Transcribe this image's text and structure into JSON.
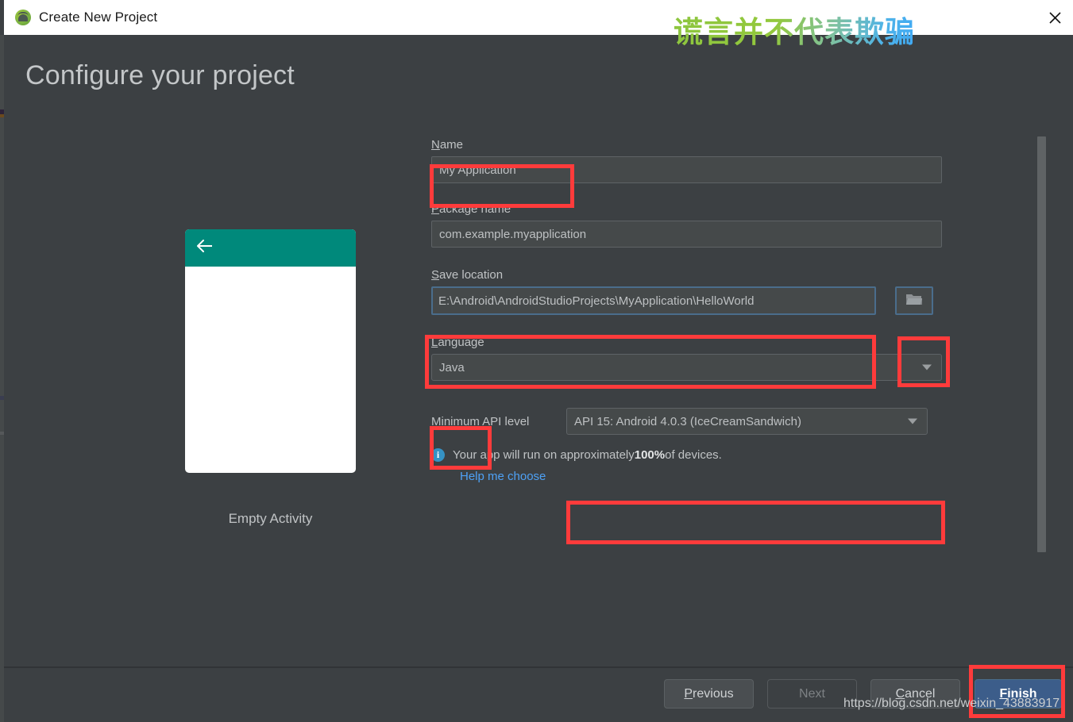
{
  "window": {
    "title": "Create New Project",
    "icon": "android-studio-icon",
    "close_label": "✕"
  },
  "watermarks": {
    "chinese": "谎言并不代表欺骗",
    "url": "https://blog.csdn.net/weixin_43883917"
  },
  "page": {
    "heading": "Configure your project"
  },
  "preview": {
    "template_name": "Empty Activity",
    "back_arrow": "←",
    "appbar_color": "#00897b"
  },
  "form": {
    "name": {
      "label_mnemonic": "N",
      "label_rest": "ame",
      "value": "My Application"
    },
    "package_name": {
      "label_mnemonic": "P",
      "label_rest": "ackage name",
      "value": "com.example.myapplication"
    },
    "save_location": {
      "label_mnemonic": "S",
      "label_rest": "ave location",
      "value": "E:\\Android\\AndroidStudioProjects\\MyApplication\\HelloWorld",
      "browse_icon": "folder-icon"
    },
    "language": {
      "label_mnemonic": "L",
      "label_rest": "anguage",
      "value": "Java"
    },
    "min_api": {
      "label": "Minimum API level",
      "value": "API 15: Android 4.0.3 (IceCreamSandwich)"
    },
    "devices_note": {
      "prefix": "Your app will run on approximately ",
      "percent": "100%",
      "suffix": " of devices.",
      "icon": "info-icon"
    },
    "help_link": "Help me choose"
  },
  "footer": {
    "previous": {
      "mnemonic": "P",
      "rest": "revious"
    },
    "next": {
      "mnemonic": "",
      "rest": "Next"
    },
    "cancel": {
      "mnemonic": "C",
      "rest": "ancel"
    },
    "finish": {
      "mnemonic": "F",
      "rest": "inish"
    }
  },
  "colors": {
    "background": "#3c4043",
    "accent_blue": "#4ea1f5",
    "primary_button": "#3c5d8a",
    "annotation_red": "#ff3b3b",
    "preview_teal": "#00897b"
  }
}
